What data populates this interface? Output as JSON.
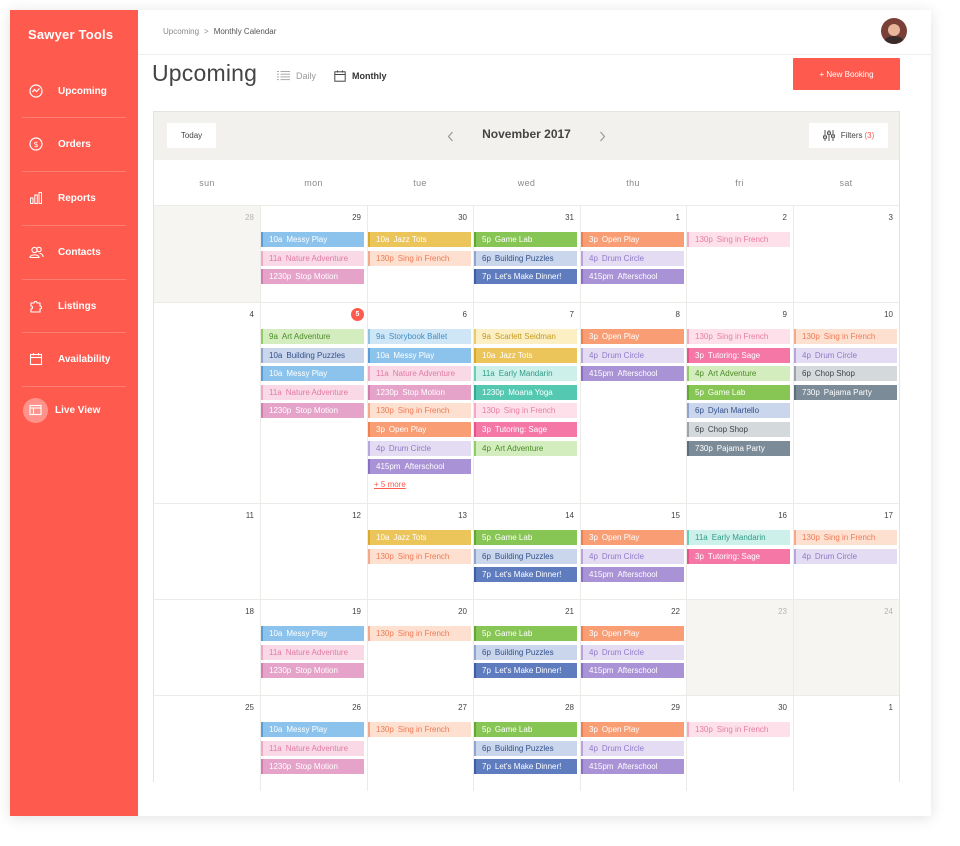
{
  "app": {
    "brand": "Sawyer Tools"
  },
  "sidebar": {
    "items": [
      {
        "label": "Upcoming",
        "icon": "upcoming-icon"
      },
      {
        "label": "Orders",
        "icon": "dollar-icon"
      },
      {
        "label": "Reports",
        "icon": "bar-chart-icon"
      },
      {
        "label": "Contacts",
        "icon": "contacts-icon"
      },
      {
        "label": "Listings",
        "icon": "puzzle-icon"
      },
      {
        "label": "Availability",
        "icon": "calendar-icon"
      },
      {
        "label": "Live View",
        "icon": "live-view-icon"
      }
    ]
  },
  "breadcrumb": {
    "parent": "Upcoming",
    "separator": ">",
    "current": "Monthly Calendar"
  },
  "header": {
    "title": "Upcoming",
    "view_daily": "Daily",
    "view_monthly": "Monthly",
    "new_booking": "+ New Booking"
  },
  "calendar": {
    "today_label": "Today",
    "month_label": "November 2017",
    "filters_label": "Filters",
    "filters_count": "(3)",
    "weekdays": [
      "sun",
      "mon",
      "tue",
      "wed",
      "thu",
      "fri",
      "sat"
    ],
    "more_label": "+ 5 more",
    "weeks": [
      [
        {
          "day": "28",
          "muted": true,
          "events": []
        },
        {
          "day": "29",
          "muted": false,
          "events": [
            [
              "10a",
              "Messy Play",
              "blue"
            ],
            [
              "11a",
              "Nature Adventure",
              "pink"
            ],
            [
              "1230p",
              "Stop Motion",
              "mauve"
            ]
          ]
        },
        {
          "day": "30",
          "muted": false,
          "events": [
            [
              "10a",
              "Jazz Tots",
              "yellow"
            ],
            [
              "130p",
              "Sing in French",
              "peach"
            ]
          ]
        },
        {
          "day": "31",
          "muted": false,
          "events": [
            [
              "5p",
              "Game Lab",
              "green"
            ],
            [
              "6p",
              "Building Puzzles",
              "steel"
            ],
            [
              "7p",
              "Let's Make Dinner!",
              "navy"
            ]
          ]
        },
        {
          "day": "1",
          "muted": false,
          "events": [
            [
              "3p",
              "Open Play",
              "orange"
            ],
            [
              "4p",
              "Drum Circle",
              "lavender"
            ],
            [
              "415pm",
              "Afterschool",
              "purple"
            ]
          ]
        },
        {
          "day": "2",
          "muted": false,
          "events": [
            [
              "130p",
              "Sing in French",
              "rose"
            ]
          ]
        },
        {
          "day": "3",
          "muted": false,
          "events": []
        }
      ],
      [
        {
          "day": "4",
          "muted": false,
          "events": []
        },
        {
          "day": "5",
          "muted": false,
          "today": true,
          "events": [
            [
              "9a",
              "Art Adventure",
              "lime"
            ],
            [
              "10a",
              "Building Puzzles",
              "steel"
            ],
            [
              "10a",
              "Messy Play",
              "blue"
            ],
            [
              "11a",
              "Nature Adventure",
              "pink"
            ],
            [
              "1230p",
              "Stop Motion",
              "mauve"
            ]
          ]
        },
        {
          "day": "6",
          "muted": false,
          "more": true,
          "events": [
            [
              "9a",
              "Storybook Ballet",
              "sky"
            ],
            [
              "10a",
              "Messy Play",
              "blue"
            ],
            [
              "11a",
              "Nature Adventure",
              "pink"
            ],
            [
              "1230p",
              "Stop Motion",
              "mauve"
            ],
            [
              "130p",
              "Sing in French",
              "peach"
            ],
            [
              "3p",
              "Open Play",
              "orange"
            ],
            [
              "4p",
              "Drum Circle",
              "lavender"
            ],
            [
              "415pm",
              "Afterschool",
              "purple"
            ]
          ]
        },
        {
          "day": "7",
          "muted": false,
          "events": [
            [
              "9a",
              "Scarlett Seidman",
              "cream"
            ],
            [
              "10a",
              "Jazz Tots",
              "yellow"
            ],
            [
              "11a",
              "Early Mandarin",
              "teal"
            ],
            [
              "1230p",
              "Moana Yoga",
              "mint"
            ],
            [
              "130p",
              "Sing in French",
              "rose"
            ],
            [
              "3p",
              "Tutoring: Sage",
              "hotpink"
            ],
            [
              "4p",
              "Art Adventure",
              "lime"
            ]
          ]
        },
        {
          "day": "8",
          "muted": false,
          "events": [
            [
              "3p",
              "Open Play",
              "orange"
            ],
            [
              "4p",
              "Drum Circle",
              "lavender"
            ],
            [
              "415pm",
              "Afterschool",
              "purple"
            ]
          ]
        },
        {
          "day": "9",
          "muted": false,
          "events": [
            [
              "130p",
              "Sing in French",
              "rose"
            ],
            [
              "3p",
              "Tutoring: Sage",
              "hotpink"
            ],
            [
              "4p",
              "Art Adventure",
              "lime"
            ],
            [
              "5p",
              "Game Lab",
              "green"
            ],
            [
              "6p",
              "Dylan Martello",
              "steel"
            ],
            [
              "6p",
              "Chop Shop",
              "gray"
            ],
            [
              "730p",
              "Pajama Party",
              "slate"
            ]
          ]
        },
        {
          "day": "10",
          "muted": false,
          "events": [
            [
              "130p",
              "Sing in French",
              "peach"
            ],
            [
              "4p",
              "Drum Circle",
              "lavender"
            ],
            [
              "6p",
              "Chop Shop",
              "gray"
            ],
            [
              "730p",
              "Pajama Party",
              "slate"
            ]
          ]
        }
      ],
      [
        {
          "day": "11",
          "muted": false,
          "events": []
        },
        {
          "day": "12",
          "muted": false,
          "events": []
        },
        {
          "day": "13",
          "muted": false,
          "events": [
            [
              "10a",
              "Jazz Tots",
              "yellow"
            ],
            [
              "130p",
              "Sing in French",
              "peach"
            ]
          ]
        },
        {
          "day": "14",
          "muted": false,
          "events": [
            [
              "5p",
              "Game Lab",
              "green"
            ],
            [
              "6p",
              "Building Puzzles",
              "steel"
            ],
            [
              "7p",
              "Let's Make Dinner!",
              "navy"
            ]
          ]
        },
        {
          "day": "15",
          "muted": false,
          "events": [
            [
              "3p",
              "Open Play",
              "orange"
            ],
            [
              "4p",
              "Drum Circle",
              "lavender"
            ],
            [
              "415pm",
              "Afterschool",
              "purple"
            ]
          ]
        },
        {
          "day": "16",
          "muted": false,
          "events": [
            [
              "11a",
              "Early Mandarin",
              "teal"
            ],
            [
              "3p",
              "Tutoring: Sage",
              "hotpink"
            ]
          ]
        },
        {
          "day": "17",
          "muted": false,
          "events": [
            [
              "130p",
              "Sing in French",
              "peach"
            ],
            [
              "4p",
              "Drum Circle",
              "lavender"
            ]
          ]
        }
      ],
      [
        {
          "day": "18",
          "muted": false,
          "events": []
        },
        {
          "day": "19",
          "muted": false,
          "events": [
            [
              "10a",
              "Messy Play",
              "blue"
            ],
            [
              "11a",
              "Nature Adventure",
              "pink"
            ],
            [
              "1230p",
              "Stop Motion",
              "mauve"
            ]
          ]
        },
        {
          "day": "20",
          "muted": false,
          "events": [
            [
              "130p",
              "Sing in French",
              "peach"
            ]
          ]
        },
        {
          "day": "21",
          "muted": false,
          "events": [
            [
              "5p",
              "Game Lab",
              "green"
            ],
            [
              "6p",
              "Building Puzzles",
              "steel"
            ],
            [
              "7p",
              "Let's Make Dinner!",
              "navy"
            ]
          ]
        },
        {
          "day": "22",
          "muted": false,
          "events": [
            [
              "3p",
              "Open Play",
              "orange"
            ],
            [
              "4p",
              "Drum Circle",
              "lavender"
            ],
            [
              "415pm",
              "Afterschool",
              "purple"
            ]
          ]
        },
        {
          "day": "23",
          "muted": true,
          "events": []
        },
        {
          "day": "24",
          "muted": true,
          "events": []
        }
      ],
      [
        {
          "day": "25",
          "muted": false,
          "events": []
        },
        {
          "day": "26",
          "muted": false,
          "events": [
            [
              "10a",
              "Messy Play",
              "blue"
            ],
            [
              "11a",
              "Nature Adventure",
              "pink"
            ],
            [
              "1230p",
              "Stop Motion",
              "mauve"
            ]
          ]
        },
        {
          "day": "27",
          "muted": false,
          "events": [
            [
              "130p",
              "Sing in French",
              "peach"
            ]
          ]
        },
        {
          "day": "28",
          "muted": false,
          "events": [
            [
              "5p",
              "Game Lab",
              "green"
            ],
            [
              "6p",
              "Building Puzzles",
              "steel"
            ],
            [
              "7p",
              "Let's Make Dinner!",
              "navy"
            ]
          ]
        },
        {
          "day": "29",
          "muted": false,
          "events": [
            [
              "3p",
              "Open Play",
              "orange"
            ],
            [
              "4p",
              "Drum Circle",
              "lavender"
            ],
            [
              "415pm",
              "Afterschool",
              "purple"
            ]
          ]
        },
        {
          "day": "30",
          "muted": false,
          "events": [
            [
              "130p",
              "Sing in French",
              "rose"
            ]
          ]
        },
        {
          "day": "1",
          "muted": false,
          "events": []
        }
      ]
    ]
  },
  "event_colors": {
    "blue": {
      "bg": "#8cc3ec",
      "border": "#5a9dd6",
      "fg": "#ffffff"
    },
    "pink": {
      "bg": "#fad9e6",
      "border": "#f0a9c4",
      "fg": "#e07aa3"
    },
    "mauve": {
      "bg": "#e6a3c9",
      "border": "#d27db0",
      "fg": "#ffffff"
    },
    "yellow": {
      "bg": "#ebc45a",
      "border": "#d9a92e",
      "fg": "#ffffff"
    },
    "peach": {
      "bg": "#fde0d0",
      "border": "#f6a98a",
      "fg": "#ef7a56"
    },
    "green": {
      "bg": "#87c655",
      "border": "#63a733",
      "fg": "#ffffff"
    },
    "steel": {
      "bg": "#c9d6ec",
      "border": "#8ea4cf",
      "fg": "#34508a"
    },
    "navy": {
      "bg": "#5f7dbe",
      "border": "#3d5ea4",
      "fg": "#ffffff"
    },
    "orange": {
      "bg": "#f99d74",
      "border": "#ee7f4f",
      "fg": "#ffffff"
    },
    "lavender": {
      "bg": "#e4dcf3",
      "border": "#b6a5de",
      "fg": "#8e7ac9"
    },
    "purple": {
      "bg": "#a993d6",
      "border": "#8670c3",
      "fg": "#ffffff"
    },
    "rose": {
      "bg": "#fde0ea",
      "border": "#f5a9c2",
      "fg": "#e67ea1"
    },
    "lime": {
      "bg": "#d3edbf",
      "border": "#8fcc63",
      "fg": "#4c8a27"
    },
    "sky": {
      "bg": "#cfe6f6",
      "border": "#8ec3e6",
      "fg": "#3f8fc6"
    },
    "cream": {
      "bg": "#fcefc4",
      "border": "#e9cc67",
      "fg": "#c29a1e"
    },
    "teal": {
      "bg": "#cdf1ea",
      "border": "#6ccdb9",
      "fg": "#2f9c86"
    },
    "mint": {
      "bg": "#55c8b2",
      "border": "#32aa94",
      "fg": "#ffffff"
    },
    "hotpink": {
      "bg": "#f577a6",
      "border": "#e6538b",
      "fg": "#ffffff"
    },
    "gray": {
      "bg": "#d4d9dc",
      "border": "#9aa4aa",
      "fg": "#3d4448"
    },
    "slate": {
      "bg": "#7b8b98",
      "border": "#5e6e7b",
      "fg": "#ffffff"
    }
  },
  "colors": {
    "accent": "#ff5a4e"
  }
}
